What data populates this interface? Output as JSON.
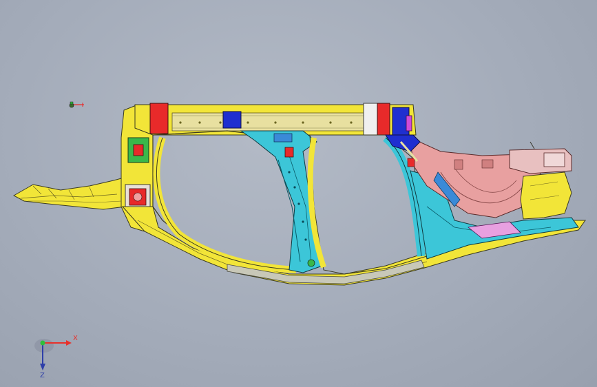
{
  "viewport": {
    "background": "#a6aebb"
  },
  "triad": {
    "x_label": "X",
    "z_label": "Z",
    "x_color": "#e8302a",
    "z_color": "#2d3ea8",
    "y_color": "#2fbf3a"
  },
  "model": {
    "name": "body-side-frame",
    "colors": {
      "yellow": "#f2e538",
      "cyan": "#3cc6d8",
      "red": "#e82a2a",
      "blue": "#1f2fd0",
      "pink": "#e8a0a0",
      "green": "#3ab84a",
      "magenta": "#d04ad8",
      "beige": "#e8e0a0",
      "gray": "#b8b8a8"
    }
  }
}
